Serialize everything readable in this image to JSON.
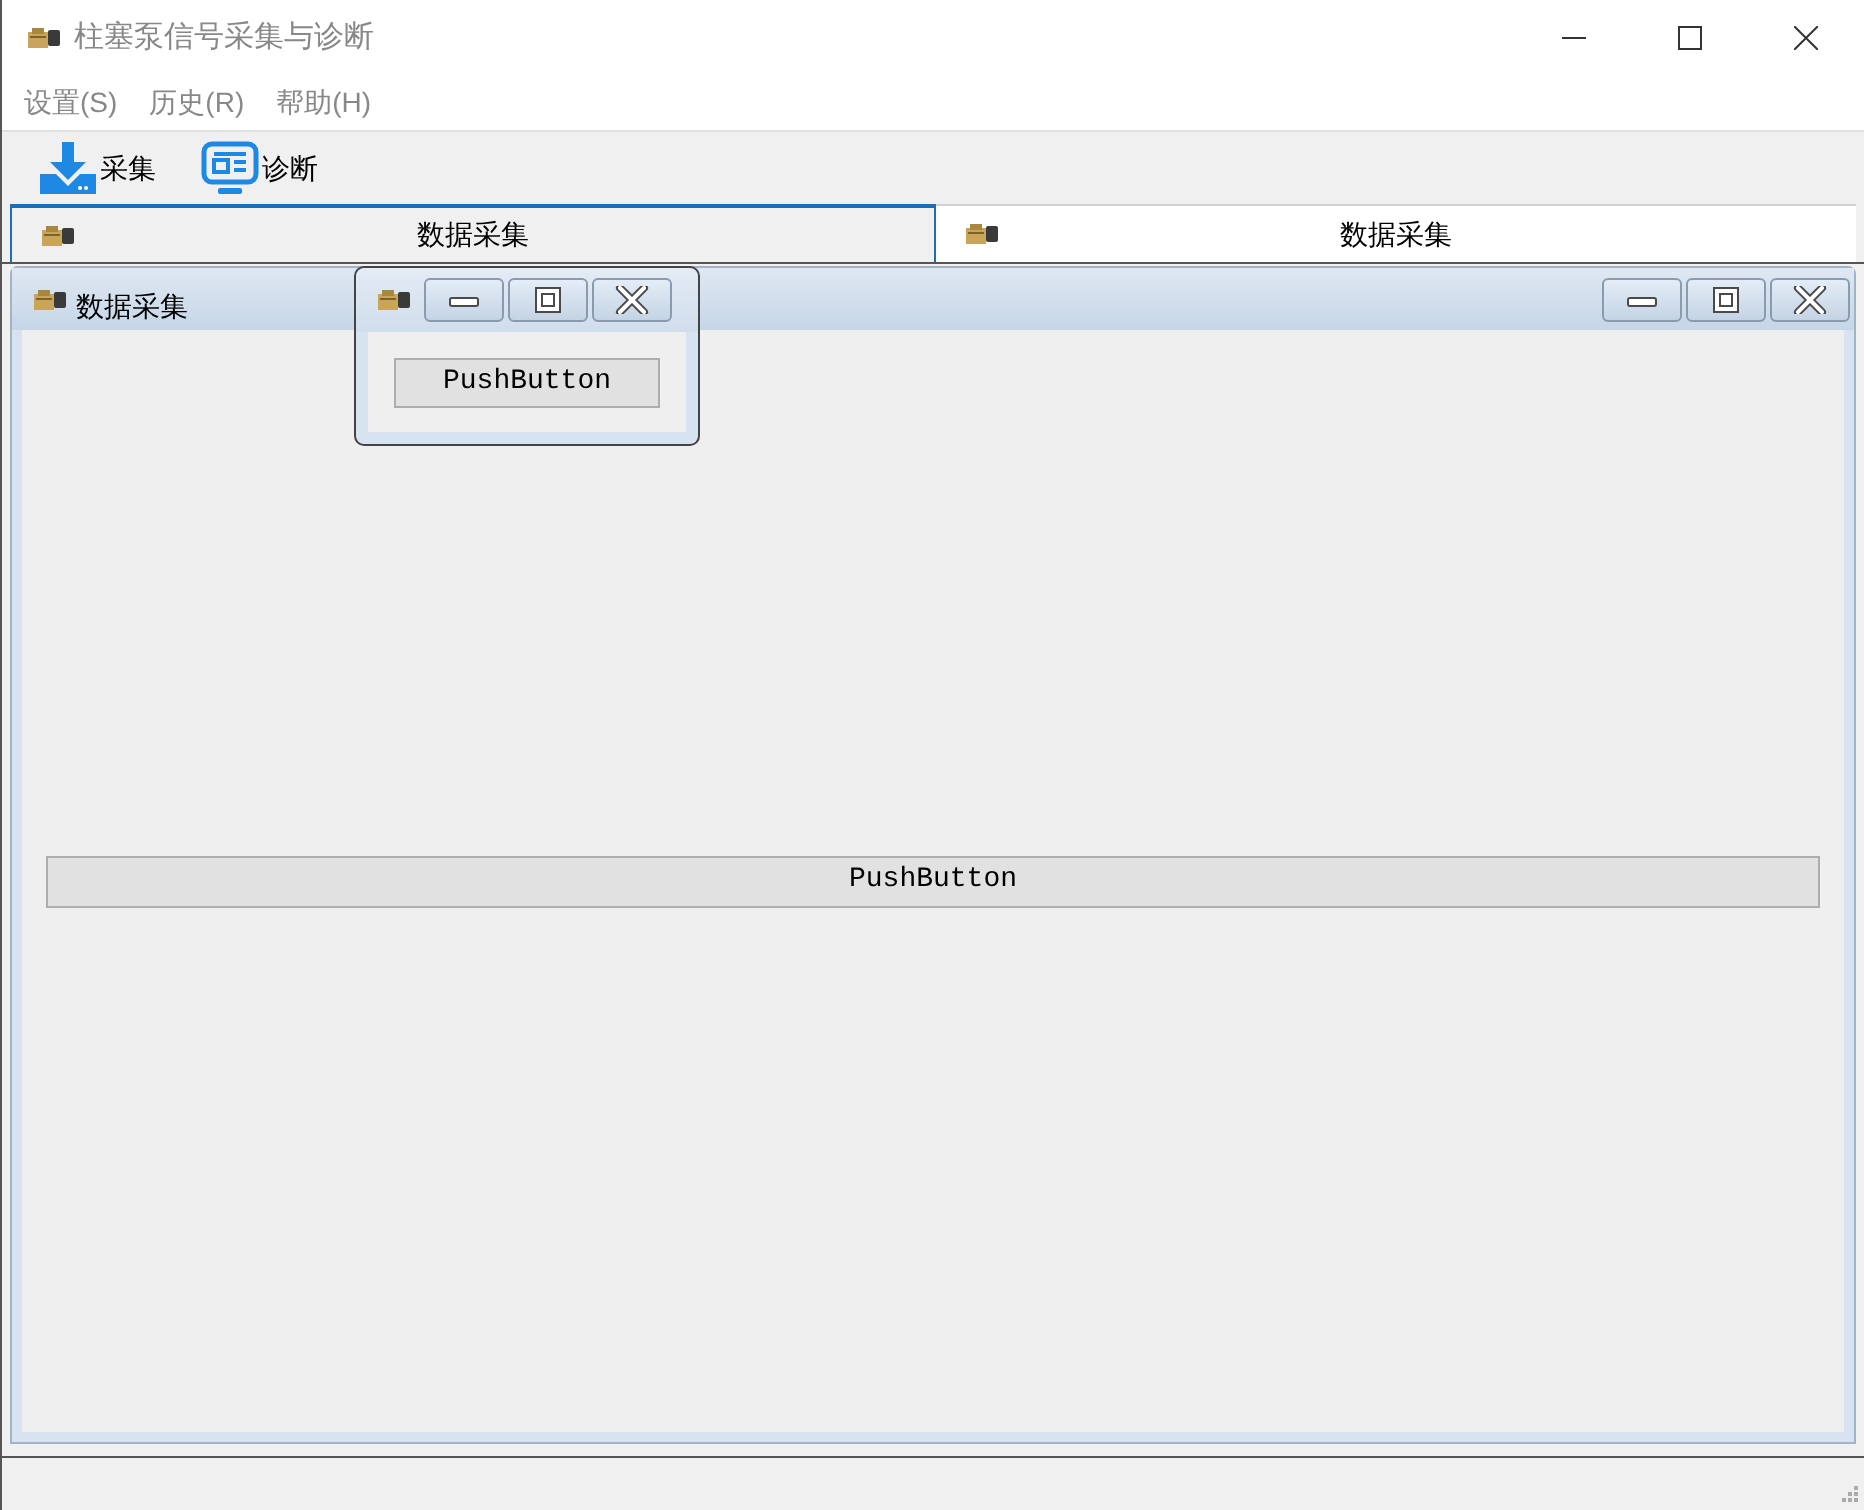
{
  "window": {
    "title": "柱塞泵信号采集与诊断"
  },
  "menu": [
    {
      "label": "设置(S)"
    },
    {
      "label": "历史(R)"
    },
    {
      "label": "帮助(H)"
    }
  ],
  "toolbar": [
    {
      "label": "采集",
      "kind": "download"
    },
    {
      "label": "诊断",
      "kind": "monitor"
    }
  ],
  "tabs": [
    {
      "label": "数据采集",
      "selected": true
    },
    {
      "label": "数据采集",
      "selected": false
    }
  ],
  "main_subwindow": {
    "title": "数据采集",
    "button": "PushButton"
  },
  "floating_subwindow": {
    "button": "PushButton"
  }
}
